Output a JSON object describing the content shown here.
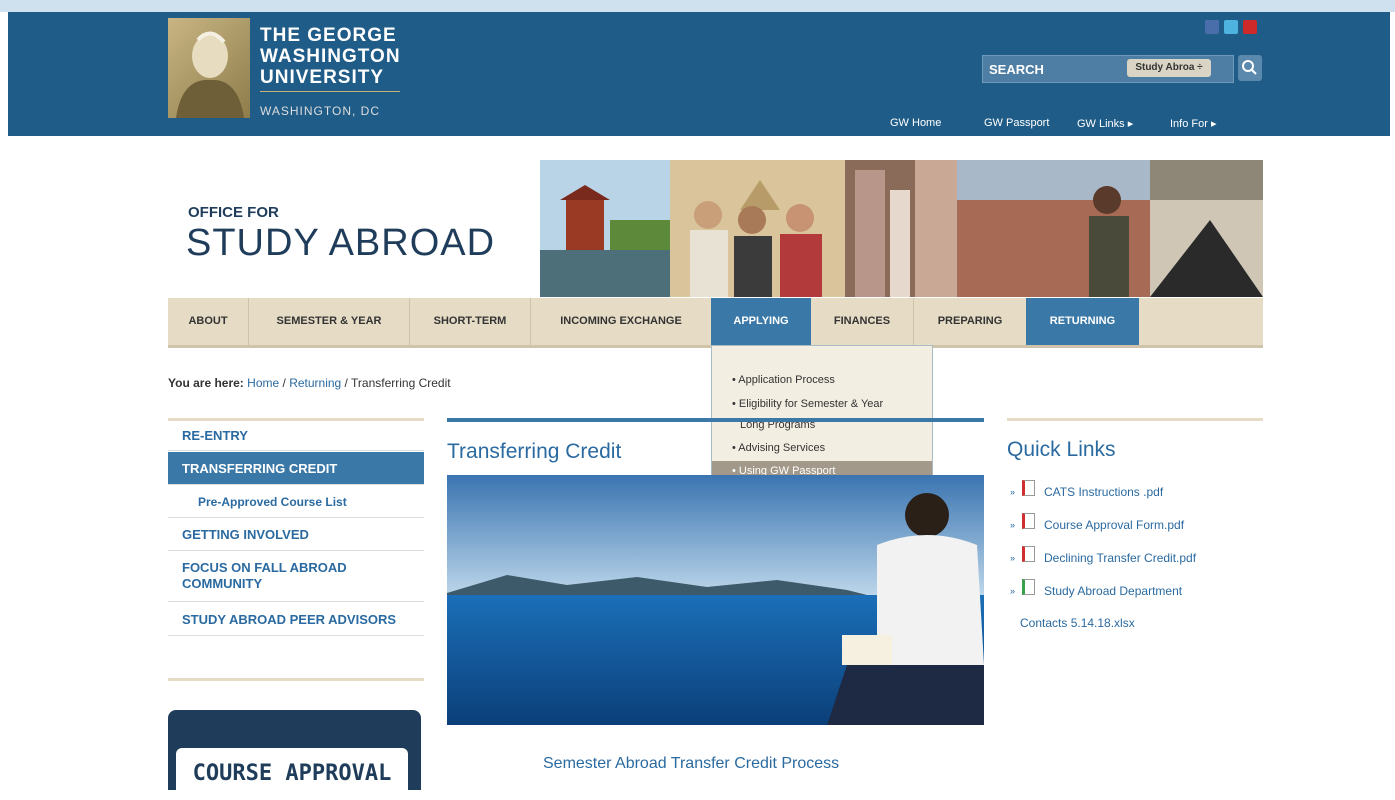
{
  "header": {
    "university_lines": [
      "THE GEORGE",
      "WASHINGTON",
      "UNIVERSITY"
    ],
    "city": "WASHINGTON, DC",
    "social_icons": [
      "facebook-icon",
      "twitter-icon",
      "youtube-icon"
    ],
    "search": {
      "label": "SEARCH",
      "scope": "Study Abroa ÷"
    },
    "top_links": [
      "GW Home",
      "GW Passport",
      "GW Links ▸",
      "Info For ▸"
    ]
  },
  "office": {
    "small": "OFFICE FOR",
    "big": "STUDY ABROAD"
  },
  "nav": {
    "items": [
      "ABOUT",
      "SEMESTER & YEAR",
      "SHORT-TERM",
      "INCOMING EXCHANGE",
      "APPLYING",
      "FINANCES",
      "PREPARING",
      "RETURNING"
    ],
    "dropdown": [
      "• Application Process",
      "• Eligibility for Semester & Year",
      "Long Programs",
      "• Advising Services",
      "• Using GW Passport"
    ]
  },
  "breadcrumb": {
    "prefix": "You are here:",
    "home": "Home",
    "sep1": " / ",
    "section": "Returning",
    "sep2": " / ",
    "current": "Transferring Credit"
  },
  "sidebar": {
    "items": [
      "RE-ENTRY",
      "TRANSFERRING CREDIT",
      "Pre-Approved Course List",
      "GETTING INVOLVED",
      "FOCUS ON FALL ABROAD",
      "COMMUNITY",
      "STUDY ABROAD PEER ADVISORS"
    ],
    "banner": "COURSE APPROVAL"
  },
  "main": {
    "title": "Transferring Credit",
    "subtitle": "Semester Abroad Transfer Credit Process"
  },
  "quick_links": {
    "title": "Quick Links",
    "items": [
      "CATS Instructions .pdf",
      "Course Approval Form.pdf",
      "Declining Transfer Credit.pdf",
      "Study Abroad Department",
      "Contacts 5.14.18.xlsx"
    ]
  },
  "colors": {
    "header_blue": "#1f5d88",
    "nav_beige": "#e6dcc6",
    "active_blue": "#3a78a8",
    "link_blue": "#2a6aa0"
  }
}
